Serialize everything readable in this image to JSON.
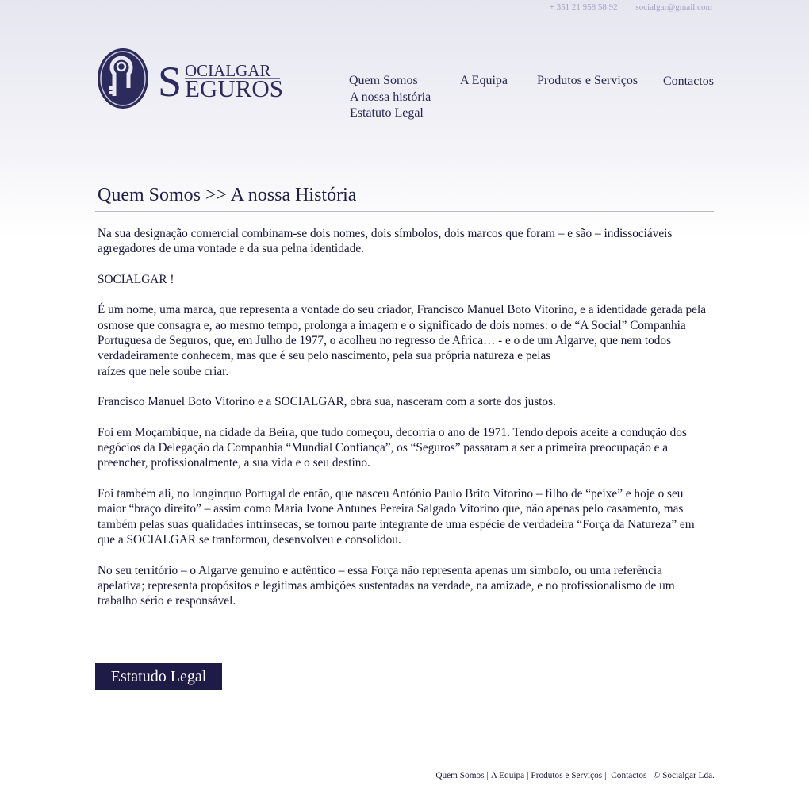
{
  "contact": {
    "phone": "+ 351 21 958 58 92",
    "email": "socialgar@gmail.com"
  },
  "logo": {
    "line1_initial": "S",
    "line1_rest": "OCIALGAR",
    "line2_initial": "S",
    "line2_rest": "EGUROS"
  },
  "nav": {
    "quem_somos": "Quem Somos",
    "nossa_historia": "A nossa história",
    "estatuto_legal": "Estatuto Legal",
    "equipa": "A Equipa",
    "produtos": "Produtos e Serviços",
    "contactos": "Contactos"
  },
  "page": {
    "title": "Quem Somos >> A nossa História",
    "paragraphs": [
      "Na sua designação comercial combinam-se dois nomes, dois símbolos, dois marcos que foram – e são – indissociáveis agregadores de uma vontade e da sua pelna identidade.",
      "SOCIALGAR !",
      "É um nome, uma marca, que representa a vontade do seu criador, Francisco Manuel Boto Vitorino, e a identidade gerada pela osmose que consagra e, ao mesmo tempo, prolonga a imagem e o significado de dois nomes: o de “A Social” Companhia Portuguesa de Seguros, que, em Julho de 1977, o acolheu no regresso de Africa… - e o de um Algarve, que nem todos verdadeiramente conhecem, mas que é seu pelo nascimento, pela sua própria natureza e pelas",
      "Francisco Manuel Boto Vitorino e a SOCIALGAR, obra sua, nasceram com a sorte dos justos.",
      "Foi em Moçambique, na cidade da Beira, que tudo começou, decorria o ano de 1971. Tendo depois aceite a condução dos negócios da Delegação da Companhia “Mundial Confiança”, os “Seguros” passaram a ser a primeira preocupação e a preencher, profissionalmente, a sua vida e o seu destino.",
      "Foi também ali, no longínquo Portugal de então, que nasceu António Paulo Brito Vitorino – filho de “peixe” e hoje o seu maior “braço direito” – assim como Maria Ivone Antunes Pereira Salgado Vitorino que, não apenas pelo casamento, mas também pelas suas qualidades intrínsecas, se tornou parte integrante de uma espécie de verdadeira “Força da Natureza” em que a SOCIALGAR se tranformou, desenvolveu e consolidou.",
      "No seu território – o Algarve genuíno e autêntico – essa Força não representa apenas um símbolo, ou uma referência apelativa; representa propósitos e legítimas ambições sustentadas na verdade, na amizade, e no profissionalismo de um trabalho sério e responsável."
    ],
    "paragraph3_tail": "raízes que nele soube criar."
  },
  "button": {
    "label": "Estatudo Legal"
  },
  "footer": {
    "quem_somos": "Quem Somos",
    "equipa": "A Equipa",
    "produtos": "Produtos e Serviços",
    "contactos": "Contactos",
    "copyright": "© Socialgar Lda."
  },
  "colors": {
    "brand": "#1e1c46",
    "accent_light": "#a2a2c8"
  },
  "icons": {
    "logo": "socialgar-key-emblem-icon"
  }
}
